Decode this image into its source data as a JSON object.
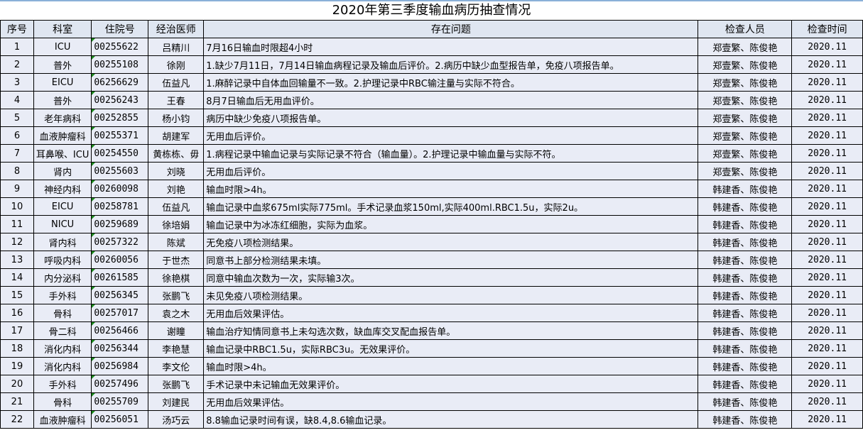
{
  "title": "2020年第三季度输血病历抽查情况",
  "headers": [
    "序号",
    "科室",
    "住院号",
    "经治医师",
    "存在问题",
    "检查人员",
    "检查时间"
  ],
  "rows": [
    [
      "1",
      "ICU",
      "00255622",
      "吕精川",
      "7月16日输血时限超4小时",
      "郑壹繁、陈俊艳",
      "2020.11"
    ],
    [
      "2",
      "普外",
      "00255108",
      "徐刚",
      "1.缺少7月11日，7月14日输血病程记录及输血后评价。2.病历中缺少血型报告单，免疫八项报告单。",
      "郑壹繁、陈俊艳",
      "2020.11"
    ],
    [
      "3",
      "EICU",
      "06256629",
      "伍益凡",
      "1.麻醉记录中自体血回输量不一致。2.护理记录中RBC输注量与实际不符合。",
      "郑壹繁、陈俊艳",
      "2020.11"
    ],
    [
      "4",
      "普外",
      "00256243",
      "王春",
      "8月7日输血后无用血评价。",
      "郑壹繁、陈俊艳",
      "2020.11"
    ],
    [
      "5",
      "老年病科",
      "00252855",
      "杨小钧",
      "病历中缺少免疫八项报告单。",
      "郑壹繁、陈俊艳",
      "2020.11"
    ],
    [
      "6",
      "血液肿瘤科",
      "00255371",
      "胡建军",
      "无用血后评价。",
      "郑壹繁、陈俊艳",
      "2020.11"
    ],
    [
      "7",
      "耳鼻喉、ICU",
      "00254550",
      "黄栋栋、毋",
      "1.病程记录中输血记录与实际记录不符合（输血量）。2.护理记录中输血量与实际不符。",
      "郑壹繁、陈俊艳",
      "2020.11"
    ],
    [
      "8",
      "肾内",
      "00255603",
      "刘晓",
      "无用血后评价。",
      "郑壹繁、陈俊艳",
      "2020.11"
    ],
    [
      "9",
      "神经内科",
      "00260098",
      "刘艳",
      "输血时限>4h。",
      "韩建香、陈俊艳",
      "2020.11"
    ],
    [
      "10",
      "EICU",
      "00258781",
      "伍益凡",
      "输血记录中血浆675ml实际775ml。手术记录血浆150ml,实际400ml.RBC1.5u，实际2u。",
      "韩建香、陈俊艳",
      "2020.11"
    ],
    [
      "11",
      "NICU",
      "00259689",
      "徐培娟",
      "输血记录中为冰冻红细胞，实际为血浆。",
      "韩建香、陈俊艳",
      "2020.11"
    ],
    [
      "12",
      "肾内科",
      "00257322",
      "陈斌",
      "无免疫八项检测结果。",
      "韩建香、陈俊艳",
      "2020.11"
    ],
    [
      "13",
      "呼吸内科",
      "00260056",
      "于世杰",
      "同意书上部分检测结果未填。",
      "韩建香、陈俊艳",
      "2020.11"
    ],
    [
      "14",
      "内分泌科",
      "00261585",
      "徐艳棋",
      "同意中输血次数为一次，实际输3次。",
      "韩建香、陈俊艳",
      "2020.11"
    ],
    [
      "15",
      "手外科",
      "00256345",
      "张鹏飞",
      "未见免疫八项检测结果。",
      "韩建香、陈俊艳",
      "2020.11"
    ],
    [
      "16",
      "骨科",
      "00257017",
      "袁之木",
      "无用血后效果评估。",
      "韩建香、陈俊艳",
      "2020.11"
    ],
    [
      "17",
      "骨二科",
      "00256466",
      "谢瞳",
      "输血治疗知情同意书上未勾选次数，缺血库交叉配血报告单。",
      "韩建香、陈俊艳",
      "2020.11"
    ],
    [
      "18",
      "消化内科",
      "00256344",
      "李艳慧",
      "输血记录中RBC1.5u，实际RBC3u。无效果评价。",
      "韩建香、陈俊艳",
      "2020.11"
    ],
    [
      "19",
      "消化内科",
      "00256984",
      "李文伦",
      "输血时限>4h。",
      "韩建香、陈俊艳",
      "2020.11"
    ],
    [
      "20",
      "手外科",
      "00257496",
      "张鹏飞",
      "手术记录中未记输血无效果评价。",
      "韩建香、陈俊艳",
      "2020.11"
    ],
    [
      "21",
      "骨科",
      "00255709",
      "刘建民",
      "无用血后效果评估。",
      "韩建香、陈俊艳",
      "2020.11"
    ],
    [
      "22",
      "血液肿瘤科",
      "00256051",
      "汤巧云",
      "8.8输血记录时间有误，缺8.4,8.6输血记录。",
      "韩建香、陈俊艳",
      "2020.11"
    ]
  ]
}
